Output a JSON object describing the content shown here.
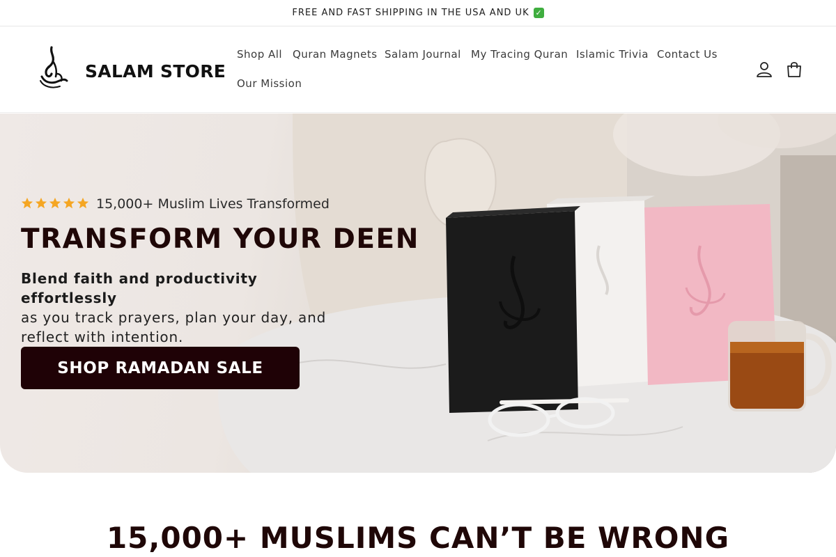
{
  "announcement": {
    "text": "FREE AND FAST SHIPPING IN THE USA AND UK",
    "check": "✓"
  },
  "brand": {
    "name": "SALAM STORE",
    "logo_icon": "arabic-calligraphy-logo"
  },
  "nav": {
    "items": [
      {
        "label": "Shop All"
      },
      {
        "label": "Quran Magnets"
      },
      {
        "label": "Salam Journal"
      },
      {
        "label": "My Tracing Quran"
      },
      {
        "label": "Islamic Trivia"
      },
      {
        "label": "Contact Us"
      },
      {
        "label": "Our Mission"
      }
    ]
  },
  "header_icons": {
    "account": "user-icon",
    "cart": "shopping-bag-icon"
  },
  "hero": {
    "rating_stars": 5,
    "rating_text": "15,000+ Muslim Lives Transformed",
    "title": "TRANSFORM YOUR DEEN",
    "subtitle_bold": "Blend faith and productivity effortlessly",
    "subtitle_rest": "as you track prayers, plan your day, and reflect with intention.",
    "cta_label": "SHOP RAMADAN SALE",
    "star_color": "#f5a623",
    "cta_color": "#1f0206"
  },
  "section": {
    "title": "15,000+ MUSLIMS CAN’T BE WRONG"
  }
}
